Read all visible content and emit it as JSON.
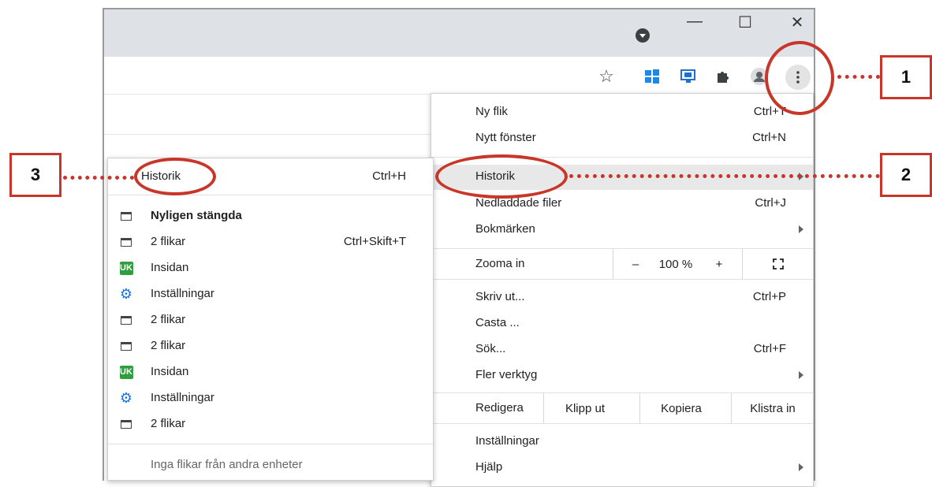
{
  "window": {
    "minimize": "—",
    "maximize": "☐",
    "close": "✕"
  },
  "toolbar": {
    "bookmark_icon": "star-icon",
    "menu_icon": "kebab-icon"
  },
  "menu": {
    "items": {
      "new_tab": {
        "label": "Ny flik",
        "shortcut": "Ctrl+T"
      },
      "new_window": {
        "label": "Nytt fönster",
        "shortcut": "Ctrl+N"
      },
      "history": {
        "label": "Historik"
      },
      "downloads": {
        "label": "Nedladdade filer",
        "shortcut": "Ctrl+J"
      },
      "bookmarks": {
        "label": "Bokmärken"
      },
      "print": {
        "label": "Skriv ut...",
        "shortcut": "Ctrl+P"
      },
      "cast": {
        "label": "Casta ..."
      },
      "find": {
        "label": "Sök...",
        "shortcut": "Ctrl+F"
      },
      "more_tools": {
        "label": "Fler verktyg"
      },
      "settings": {
        "label": "Inställningar"
      },
      "help": {
        "label": "Hjälp"
      }
    },
    "zoom": {
      "label": "Zooma in",
      "minus": "–",
      "value": "100 %",
      "plus": "+"
    },
    "edit": {
      "label": "Redigera",
      "cut": "Klipp ut",
      "copy": "Kopiera",
      "paste": "Klistra in"
    }
  },
  "submenu": {
    "title": "Historik",
    "title_shortcut": "Ctrl+H",
    "recently_closed": "Nyligen stängda",
    "items": [
      {
        "icon": "tab-icon",
        "label": "2 flikar",
        "shortcut": "Ctrl+Skift+T"
      },
      {
        "icon": "uk-icon",
        "label": "Insidan",
        "icon_text": "UK"
      },
      {
        "icon": "gear-icon",
        "label": "Inställningar"
      },
      {
        "icon": "tab-icon",
        "label": "2 flikar"
      },
      {
        "icon": "tab-icon",
        "label": "2 flikar"
      },
      {
        "icon": "uk-icon",
        "label": "Insidan",
        "icon_text": "UK"
      },
      {
        "icon": "gear-icon",
        "label": "Inställningar"
      },
      {
        "icon": "tab-icon",
        "label": "2 flikar"
      }
    ],
    "no_other_devices": "Inga flikar från andra enheter"
  },
  "annotations": {
    "one": "1",
    "two": "2",
    "three": "3"
  },
  "colors": {
    "accent_red": "#c8362a",
    "menu_highlight": "#e8e8e8",
    "gear_blue": "#1a73e8",
    "uk_green": "#2e9e3e"
  }
}
